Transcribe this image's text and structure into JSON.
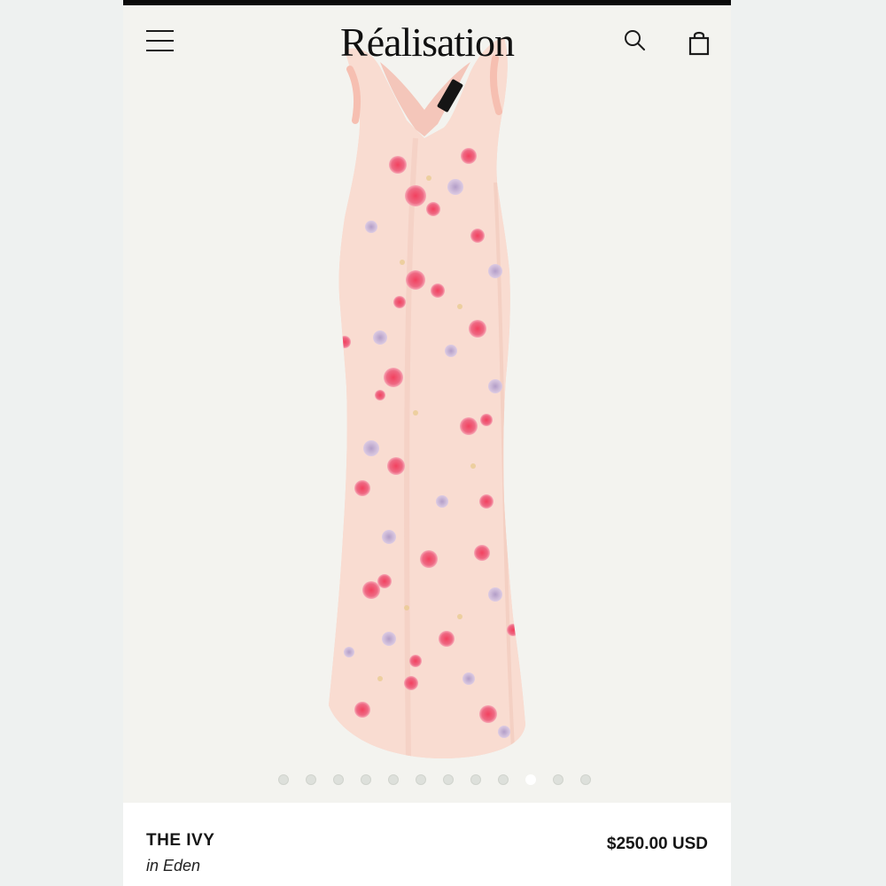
{
  "header": {
    "logo": "Réalisation",
    "menu_icon": "hamburger-menu-icon",
    "search_icon": "search-icon",
    "bag_icon": "shopping-bag-icon"
  },
  "gallery": {
    "image_description_icon": "dress-image",
    "slide_count": 12,
    "active_slide": 10
  },
  "product": {
    "name": "THE IVY",
    "color": "in Eden",
    "price": "$250.00 USD"
  },
  "colors": {
    "dress_base": "#f7d3c8",
    "flower_pink": "#ea5a7a",
    "flower_lilac": "#b9a4d2",
    "background": "#f3f3ef"
  }
}
